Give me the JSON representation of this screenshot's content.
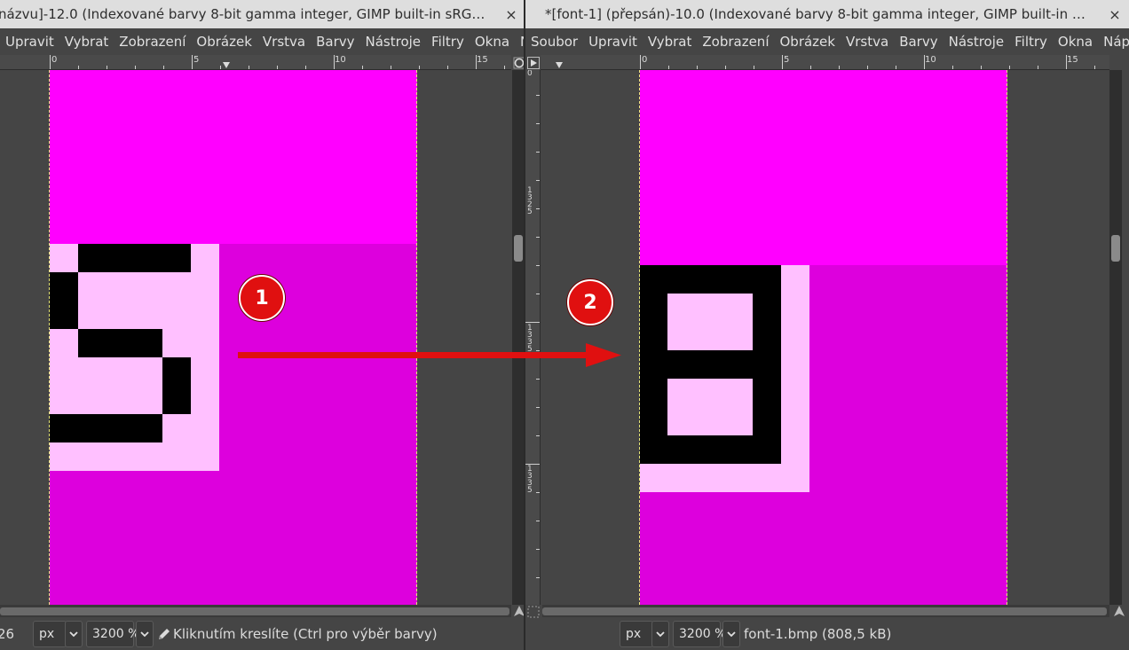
{
  "colors": {
    "magenta": "#ff00ff",
    "dark_magenta": "#dd00dd",
    "light_pink": "#ffc0ff",
    "black": "#000000",
    "annotation_red": "#e01010"
  },
  "left_window": {
    "title": "názvu]-12.0 (Indexované barvy 8-bit gamma integer, GIMP built-in sRG…",
    "close": "×",
    "menu": [
      "Upravit",
      "Vybrat",
      "Zobrazení",
      "Obrázek",
      "Vrstva",
      "Barvy",
      "Nástroje",
      "Filtry",
      "Okna",
      "Nápc"
    ],
    "ruler_labels": [
      "0",
      "5",
      "10",
      "15"
    ],
    "status": {
      "coord": "26",
      "unit": "px",
      "zoom": "3200 %",
      "message": "Kliknutím kreslíte (Ctrl pro výběr barvy)"
    }
  },
  "right_window": {
    "title": "*[font-1] (přepsán)-10.0 (Indexované barvy 8-bit gamma integer, GIMP built-in …",
    "close": "×",
    "menu": [
      "Soubor",
      "Upravit",
      "Vybrat",
      "Zobrazení",
      "Obrázek",
      "Vrstva",
      "Barvy",
      "Nástroje",
      "Filtry",
      "Okna",
      "Nápov"
    ],
    "ruler_labels": [
      "0",
      "5",
      "10",
      "15"
    ],
    "vruler_labels": [
      "0",
      "1325",
      "1335",
      "1335"
    ],
    "status": {
      "unit": "px",
      "zoom": "3200 %",
      "file_info": "font-1.bmp (808,5 kB)"
    }
  },
  "annotations": {
    "badge1": "1",
    "badge2": "2"
  },
  "icons": {
    "pencil": "pencil-icon",
    "chevron": "chevron-down-icon",
    "navigate": "navigate-icon",
    "quick_mask": "quick-mask-icon",
    "zoom_lock": "zoom-icon",
    "menu_triangle": "menu-arrow-icon"
  }
}
